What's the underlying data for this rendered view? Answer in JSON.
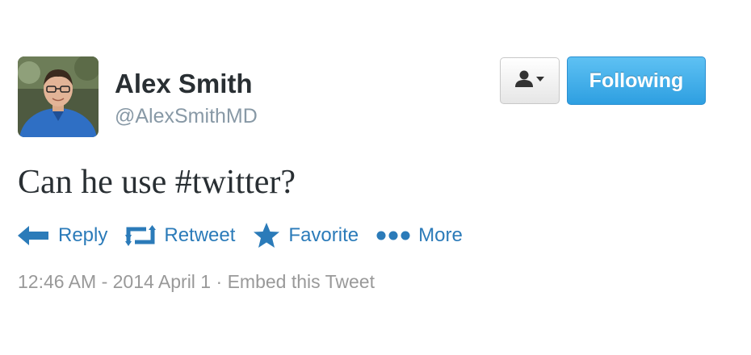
{
  "author": {
    "name": "Alex Smith",
    "handle": "@AlexSmithMD"
  },
  "buttons": {
    "follow_label": "Following",
    "user_dropdown_icon": "user-caret-icon"
  },
  "tweet": {
    "text": "Can he use #twitter?"
  },
  "actions": [
    {
      "label": "Reply",
      "icon": "reply-icon"
    },
    {
      "label": "Retweet",
      "icon": "retweet-icon"
    },
    {
      "label": "Favorite",
      "icon": "star-icon"
    },
    {
      "label": "More",
      "icon": "more-dots-icon"
    }
  ],
  "meta": {
    "timestamp": "12:46 AM - 2014 April 1",
    "separator": "·",
    "embed_label": "Embed this Tweet"
  },
  "colors": {
    "action_blue": "#2b7bb9",
    "follow_blue": "#3aa8e8",
    "text_dark": "#292f33",
    "muted_gray": "#999999"
  }
}
